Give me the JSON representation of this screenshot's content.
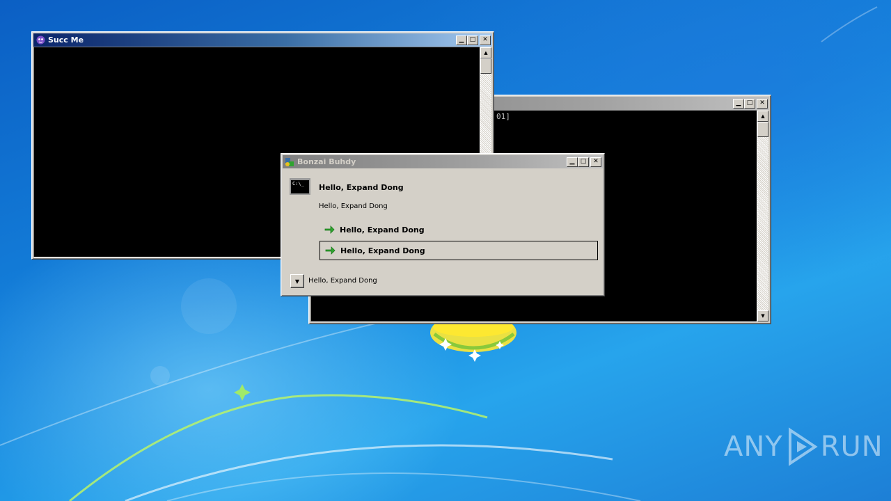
{
  "desktop": {
    "watermark": {
      "left_text": "ANY",
      "right_text": "RUN"
    }
  },
  "windows": {
    "succ_me": {
      "title": "Succ Me",
      "controls": {
        "minimize": "0",
        "maximize": "1",
        "close": "r"
      }
    },
    "back_console": {
      "title": "",
      "visible_text": "01]",
      "controls": {
        "minimize": "0",
        "maximize": "1",
        "close": "r"
      }
    },
    "bonzai": {
      "title": "Bonzai Buhdy",
      "cmd_icon_text": "C:\\_",
      "heading": "Hello, Expand Dong",
      "subtext": "Hello, Expand Dong",
      "command_links": [
        {
          "label": "Hello, Expand Dong",
          "icon": "green-arrow-icon"
        },
        {
          "label": "Hello, Expand Dong",
          "icon": "green-arrow-icon",
          "focused": true
        }
      ],
      "expando_label": "Hello, Expand Dong"
    }
  },
  "colors": {
    "titlebar_active": "#0a246a",
    "titlebar_inactive": "#808080",
    "window_face": "#d4d0c8",
    "console_bg": "#000000",
    "arrow_green": "#2fa42f"
  }
}
